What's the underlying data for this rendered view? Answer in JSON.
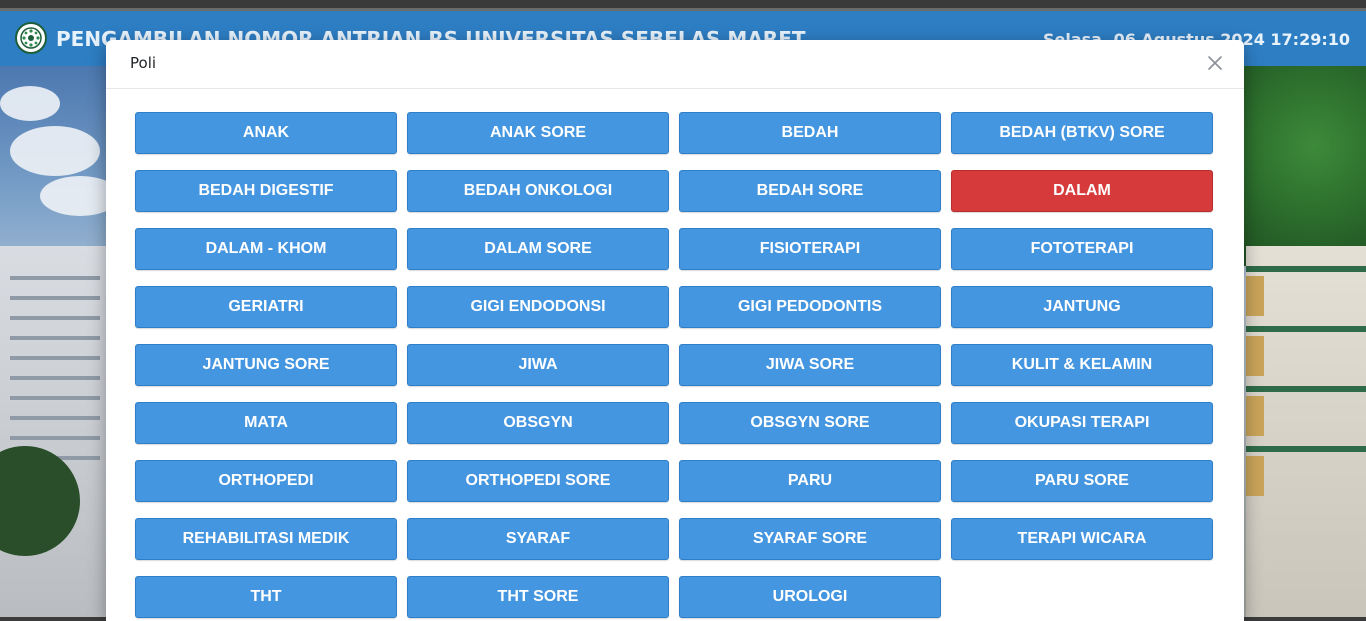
{
  "header": {
    "title": "PENGAMBILAN NOMOR ANTRIAN RS UNIVERSITAS SEBELAS MARET",
    "datetime": "Selasa, 06 Agustus 2024 17:29:10",
    "logo_icon": "hospital-logo-icon"
  },
  "modal": {
    "title": "Poli",
    "close_icon": "close-icon"
  },
  "colors": {
    "header_bg": "#2e7ec4",
    "button_blue": "#4596e0",
    "button_selected": "#d63a3a"
  },
  "poli": [
    {
      "label": "ANAK",
      "selected": false
    },
    {
      "label": "ANAK SORE",
      "selected": false
    },
    {
      "label": "BEDAH",
      "selected": false
    },
    {
      "label": "BEDAH (BTKV) SORE",
      "selected": false
    },
    {
      "label": "BEDAH DIGESTIF",
      "selected": false
    },
    {
      "label": "BEDAH ONKOLOGI",
      "selected": false
    },
    {
      "label": "BEDAH SORE",
      "selected": false
    },
    {
      "label": "DALAM",
      "selected": true
    },
    {
      "label": "DALAM - KHOM",
      "selected": false
    },
    {
      "label": "DALAM SORE",
      "selected": false
    },
    {
      "label": "FISIOTERAPI",
      "selected": false
    },
    {
      "label": "FOTOTERAPI",
      "selected": false
    },
    {
      "label": "GERIATRI",
      "selected": false
    },
    {
      "label": "GIGI ENDODONSI",
      "selected": false
    },
    {
      "label": "GIGI PEDODONTIS",
      "selected": false
    },
    {
      "label": "JANTUNG",
      "selected": false
    },
    {
      "label": "JANTUNG SORE",
      "selected": false
    },
    {
      "label": "JIWA",
      "selected": false
    },
    {
      "label": "JIWA SORE",
      "selected": false
    },
    {
      "label": "KULIT & KELAMIN",
      "selected": false
    },
    {
      "label": "MATA",
      "selected": false
    },
    {
      "label": "OBSGYN",
      "selected": false
    },
    {
      "label": "OBSGYN SORE",
      "selected": false
    },
    {
      "label": "OKUPASI TERAPI",
      "selected": false
    },
    {
      "label": "ORTHOPEDI",
      "selected": false
    },
    {
      "label": "ORTHOPEDI SORE",
      "selected": false
    },
    {
      "label": "PARU",
      "selected": false
    },
    {
      "label": "PARU SORE",
      "selected": false
    },
    {
      "label": "REHABILITASI MEDIK",
      "selected": false
    },
    {
      "label": "SYARAF",
      "selected": false
    },
    {
      "label": "SYARAF SORE",
      "selected": false
    },
    {
      "label": "TERAPI WICARA",
      "selected": false
    },
    {
      "label": "THT",
      "selected": false
    },
    {
      "label": "THT SORE",
      "selected": false
    },
    {
      "label": "UROLOGI",
      "selected": false
    }
  ]
}
